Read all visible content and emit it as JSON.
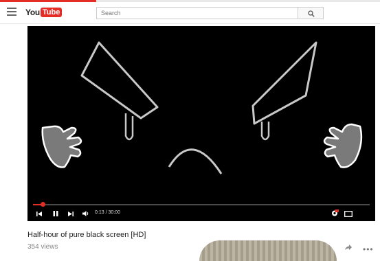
{
  "header": {
    "logo_you": "You",
    "logo_tube": "Tube",
    "search_placeholder": "Search"
  },
  "player": {
    "time_current": "0:13",
    "time_total": "30:00",
    "time_display": "0:13 / 30:00",
    "progress_fraction": 0.007,
    "accent_color": "#e52d27"
  },
  "video": {
    "title": "Half-hour of pure black screen [HD]",
    "views": "354 views"
  },
  "icons": [
    "menu-icon",
    "search-icon",
    "prev-icon",
    "pause-icon",
    "next-icon",
    "volume-icon",
    "settings-icon",
    "theater-icon",
    "share-icon",
    "more-icon"
  ]
}
